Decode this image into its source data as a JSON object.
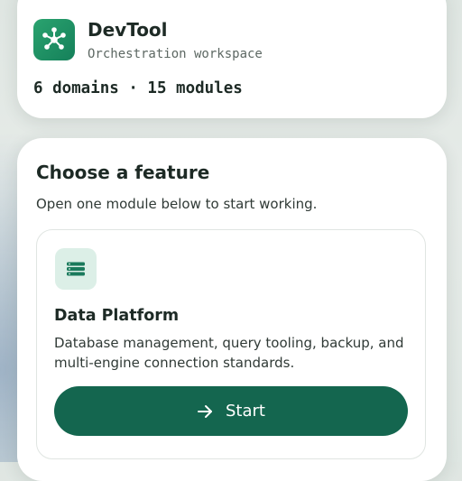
{
  "app": {
    "name": "DevTool",
    "subtitle": "Orchestration workspace",
    "stats": "6 domains · 15 modules",
    "icon": "network-nodes-icon"
  },
  "main": {
    "title": "Choose a feature",
    "subtitle": "Open one module below to start working."
  },
  "feature": {
    "icon": "database-stack-icon",
    "title": "Data Platform",
    "description": "Database management, query tooling, backup, and multi-engine connection standards.",
    "button_label": "Start",
    "button_icon": "arrow-right-icon"
  },
  "colors": {
    "accent": "#14664f",
    "icon_gradient_start": "#2aa36f",
    "icon_gradient_end": "#15805a",
    "feature_icon_bg": "#dcefe7"
  }
}
